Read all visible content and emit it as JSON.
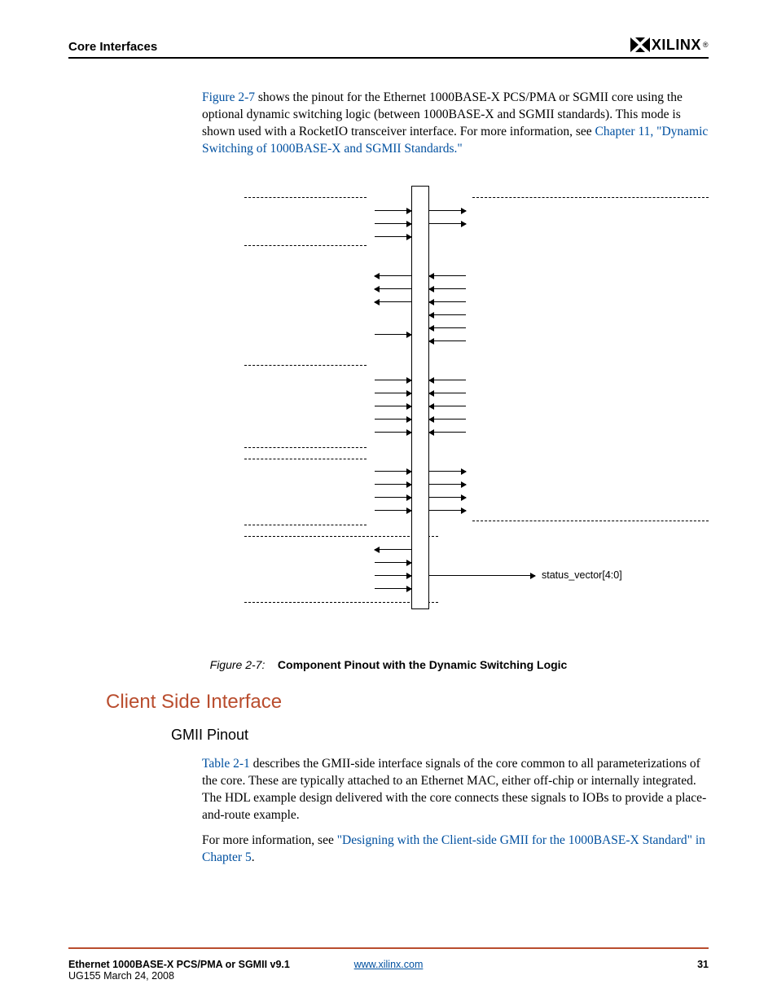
{
  "header": {
    "section": "Core Interfaces",
    "brand": "XILINX",
    "reg": "®"
  },
  "para1": {
    "link1": "Figure 2-7",
    "text1": " shows the pinout for the Ethernet 1000BASE-X PCS/PMA or SGMII core using the optional dynamic switching logic (between 1000BASE-X and SGMII standards). This mode is shown used with a RocketIO transceiver interface. For more information, see ",
    "link2": "Chapter 11, \"Dynamic Switching of 1000BASE-X and SGMII Standards.\""
  },
  "figure": {
    "signal_label": "status_vector[4:0]"
  },
  "caption": {
    "num": "Figure 2-7:",
    "title": "Component Pinout with the Dynamic Switching Logic"
  },
  "headings": {
    "h2": "Client Side Interface",
    "h3": "GMII Pinout"
  },
  "para2": {
    "link1": "Table 2-1",
    "text1": " describes the GMII-side interface signals of the core common to all parameterizations of the core. These are typically attached to an Ethernet MAC, either off-chip or internally integrated. The HDL example design delivered with the core connects these signals to IOBs to provide a place-and-route example."
  },
  "para3": {
    "text1": "For more information, see ",
    "link1": "\"Designing with the Client-side GMII for the 1000BASE-X Standard\" in Chapter 5",
    "text2": "."
  },
  "footer": {
    "title": "Ethernet 1000BASE-X PCS/PMA or SGMII v9.1",
    "sub": "UG155 March 24, 2008",
    "url": "www.xilinx.com",
    "page": "31"
  }
}
